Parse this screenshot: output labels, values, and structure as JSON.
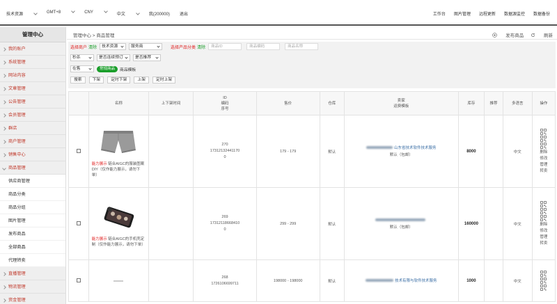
{
  "topbar": {
    "left": [
      {
        "label": "技术资源",
        "caret": true
      },
      {
        "label": "GMT+8",
        "caret": true
      },
      {
        "label": "CNY",
        "caret": true
      },
      {
        "label": "中文",
        "caret": true
      },
      {
        "label": "我(200000)",
        "caret": false
      },
      {
        "label": "退出",
        "caret": false
      }
    ],
    "right": [
      "工作台",
      "图片管理",
      "远程更新",
      "数据源监控",
      "数据备份"
    ]
  },
  "sidebar": {
    "title": "管理中心",
    "items": [
      {
        "label": "我的账户",
        "type": "group"
      },
      {
        "label": "系统管理",
        "type": "group"
      },
      {
        "label": "网站内容",
        "type": "group"
      },
      {
        "label": "文章管理",
        "type": "group"
      },
      {
        "label": "公告管理",
        "type": "group"
      },
      {
        "label": "会员管理",
        "type": "group"
      },
      {
        "label": "群店",
        "type": "group"
      },
      {
        "label": "商户管理",
        "type": "group"
      },
      {
        "label": "销售中心",
        "type": "group"
      },
      {
        "label": "商品管理",
        "type": "group-open"
      },
      {
        "label": "供应商管理",
        "type": "sub"
      },
      {
        "label": "商品分类",
        "type": "sub"
      },
      {
        "label": "商品分组",
        "type": "sub"
      },
      {
        "label": "图片管理",
        "type": "sub"
      },
      {
        "label": "发布商品",
        "type": "sub"
      },
      {
        "label": "全部商品",
        "type": "sub-active"
      },
      {
        "label": "代理转卖",
        "type": "sub"
      },
      {
        "label": "直播管理",
        "type": "group"
      },
      {
        "label": "物流管理",
        "type": "group"
      },
      {
        "label": "资金管理",
        "type": "group"
      }
    ]
  },
  "breadcrumb": "管理中心 > 商品管理",
  "actions": {
    "publish": "发布商品",
    "refresh": "刷新"
  },
  "filters": {
    "merchant_label": "选择商户",
    "clear1": "清除",
    "sel_resource": "技术资源",
    "sel_service": "服务商",
    "category_label": "选择产品分类",
    "clear2": "清除",
    "ph_id": "商品ID",
    "ph_code": "商品编码",
    "ph_name": "商品名称",
    "sel_sort": "秒杀",
    "sel_presale": "是否连续预订",
    "sel_recommend": "是否推荐",
    "sel_status": "在售",
    "tab_normal": "常规商品",
    "tab_template": "商品模板",
    "btn_search": "搜索",
    "btn_down": "下架",
    "btn_timed_down": "定时下架",
    "btn_up": "上架",
    "btn_timed_up": "定时上架"
  },
  "table": {
    "headers": {
      "name": "名称",
      "time": "上下架时间",
      "id": [
        "ID",
        "编码",
        "序号"
      ],
      "price": "售价",
      "warehouse": "仓库",
      "seller": [
        "卖家",
        "运费模板"
      ],
      "stock": "库存",
      "recommend": "推荐",
      "lang": "多语言",
      "ops": "操作"
    },
    "rows": [
      {
        "img": "shorts",
        "tag": "能力展示",
        "desc": "链合AIGC的服装图案DIY（仅作能力展示，请勿下单）",
        "id": "270",
        "code": "17312132441170",
        "seq": "0",
        "price": "179 - 179",
        "warehouse": "默认",
        "seller_text": "山东省技术软件技术服务",
        "shipping": "默认（包邮）",
        "stock": "8000",
        "lang": "中文",
        "ops": [
          "删除",
          "修改",
          "管理",
          "转卖"
        ]
      },
      {
        "img": "phonecase",
        "tag": "能力展示",
        "desc": "链合AIGC的手机壳定制（仅作能力展示，请勿下单）",
        "id": "269",
        "code": "17312118668410",
        "seq": "0",
        "price": "299 - 299",
        "warehouse": "默认",
        "seller_text": "",
        "shipping": "默认（包邮）",
        "stock": "160000",
        "lang": "中文",
        "ops": [
          "删除",
          "修改",
          "管理",
          "转卖"
        ]
      },
      {
        "img": "blank",
        "tag": "",
        "desc": "",
        "id": "268",
        "code": "1726106699711",
        "seq": "",
        "price": "198000 - 198000",
        "warehouse": "默认",
        "seller_text": "技术有限与软件技术服务",
        "shipping": "",
        "stock": "1000",
        "lang": "中文",
        "ops": []
      }
    ]
  }
}
